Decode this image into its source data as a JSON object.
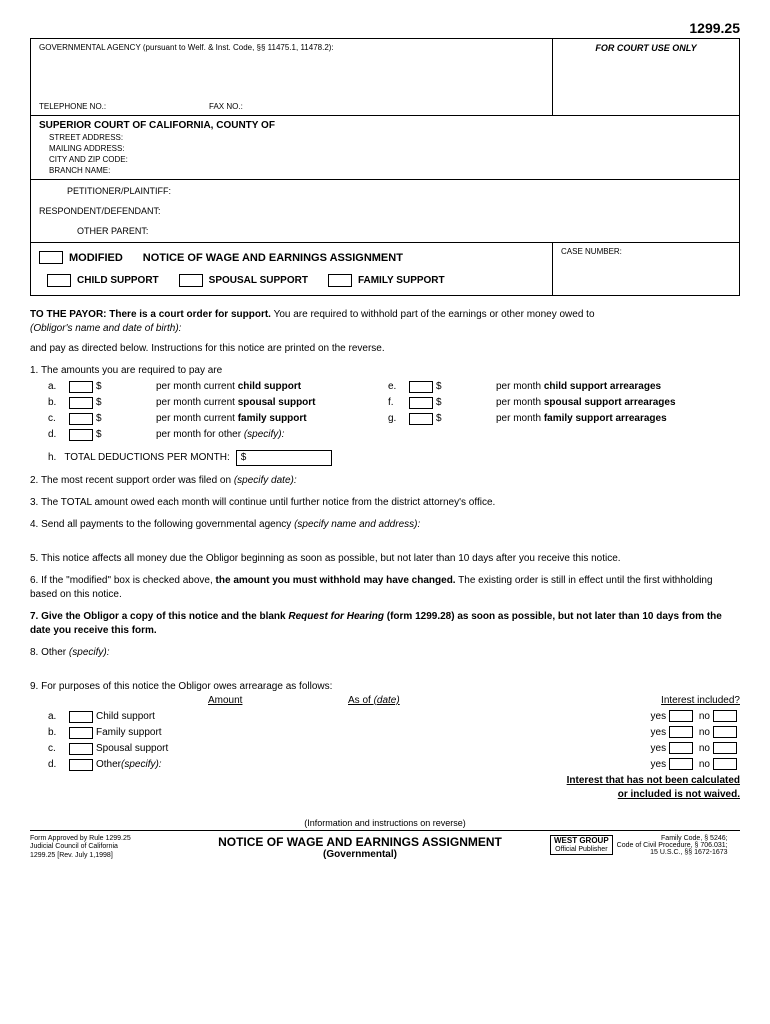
{
  "form_number": "1299.25",
  "header": {
    "agency_label": "GOVERNMENTAL AGENCY (pursuant to Welf. & Inst. Code, §§ 11475.1, 11478.2):",
    "telephone_label": "TELEPHONE NO.:",
    "fax_label": "FAX NO.:",
    "court_use": "FOR COURT USE ONLY"
  },
  "court": {
    "title": "SUPERIOR COURT OF CALIFORNIA, COUNTY OF",
    "street": "STREET ADDRESS:",
    "mailing": "MAILING ADDRESS:",
    "city": "CITY AND ZIP CODE:",
    "branch": "BRANCH NAME:"
  },
  "parties": {
    "petitioner": "PETITIONER/PLAINTIFF:",
    "respondent": "RESPONDENT/DEFENDANT:",
    "other": "OTHER PARENT:"
  },
  "title_section": {
    "modified": "MODIFIED",
    "notice": "NOTICE OF WAGE AND EARNINGS ASSIGNMENT",
    "child": "CHILD SUPPORT",
    "spousal": "SPOUSAL SUPPORT",
    "family": "FAMILY SUPPORT",
    "case_number": "CASE NUMBER:"
  },
  "payor": {
    "intro_bold": "TO THE PAYOR:  There is a court order for support.",
    "intro_rest": " You are required to withhold part of the earnings or other money owed to",
    "obligor": "(Obligor's name and date of birth):",
    "directed": "and pay as directed below.  Instructions for this notice are printed on the reverse."
  },
  "item1": {
    "text": "The amounts you are required to pay are",
    "a": "a.",
    "b": "b.",
    "c": "c.",
    "d": "d.",
    "e": "e.",
    "f": "f.",
    "g": "g.",
    "h": "h.",
    "dollar": "$",
    "child": "per month current ",
    "child_b": "child support",
    "spousal": "per month current ",
    "spousal_b": "spousal support",
    "family_curr": "per month current ",
    "family_b": "family support",
    "other": "per month for other ",
    "other_i": "(specify):",
    "child_arr": "per month ",
    "child_arr_b": "child support arrearages",
    "spousal_arr": "per month ",
    "spousal_arr_b": "spousal support arrearages",
    "family_arr": "per month ",
    "family_arr_b": "family support arrearages",
    "total": "TOTAL DEDUCTIONS PER MONTH:",
    "total_dollar": "$"
  },
  "item2": "The most recent support order was filed on ",
  "item2_i": "(specify date):",
  "item3": "The TOTAL amount owed each month will continue until further notice from the district attorney's office.",
  "item4": "Send all payments to the following governmental agency ",
  "item4_i": "(specify name and address):",
  "item5": "This notice affects all money due the Obligor beginning as soon as possible, but not later than 10 days after you receive this notice.",
  "item6_a": "If the \"modified\" box is checked above, ",
  "item6_b": "the amount you must withhold may have changed.",
  "item6_c": "  The existing order is still in effect until the first withholding based on this notice.",
  "item7_a": "Give the Obligor a copy of this notice and the blank ",
  "item7_b": "Request for Hearing",
  "item7_c": " (form 1299.28) as soon as possible, but not later than 10 days from the date you receive this form.",
  "item8": "Other ",
  "item8_i": "(specify):",
  "item9": {
    "text": "For purposes of this notice the Obligor owes arrearage as follows:",
    "amount": "Amount",
    "asof": "As of ",
    "asof_i": "(date)",
    "interest": "Interest included?",
    "child": "Child support",
    "family": "Family support",
    "spousal": "Spousal support",
    "other": "Other ",
    "other_i": "(specify):",
    "yes": "yes",
    "no": "no",
    "note": "Interest that has not been calculated",
    "note2": "or included is not waived."
  },
  "footer": {
    "info": "(Information and instructions on reverse)",
    "approved": "Form Approved by Rule 1299.25",
    "council": "Judicial Council of California",
    "rev": "1299.25 [Rev. July 1,1998]",
    "title": "NOTICE OF WAGE AND EARNINGS ASSIGNMENT",
    "sub": "(Governmental)",
    "west": "WEST GROUP",
    "west_sub": "Official Publisher",
    "codes1": "Family Code, § 5246;",
    "codes2": "Code of Civil Procedure, § 706.031;",
    "codes3": "15 U.S.C., §§ 1672-1673"
  },
  "nums": {
    "n1": "1.",
    "n2": "2.",
    "n3": "3.",
    "n4": "4.",
    "n5": "5.",
    "n6": "6.",
    "n7": "7.",
    "n8": "8.",
    "n9": "9."
  }
}
